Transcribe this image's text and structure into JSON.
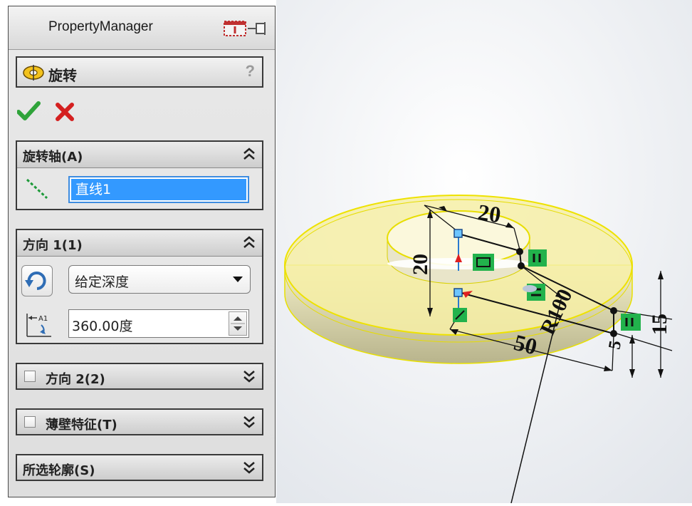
{
  "panel": {
    "title": "PropertyManager",
    "feature_name": "旋转",
    "help_label": "?",
    "ok_icon": "checkmark-icon",
    "cancel_icon": "x-icon",
    "colors": {
      "ok": "#2fa33a",
      "cancel": "#d42020",
      "selection": "#3399ff"
    }
  },
  "axis_group": {
    "label": "旋转轴(A)",
    "value": "直线1"
  },
  "direction1": {
    "label": "方向 1(1)",
    "end_condition": "给定深度",
    "angle": "360.00度"
  },
  "direction2": {
    "label": "方向 2(2)"
  },
  "thin_feature": {
    "label": "薄壁特征(T)"
  },
  "selected_contours": {
    "label": "所选轮廓(S)"
  },
  "sketch": {
    "dimensions": [
      "20",
      "20",
      "50",
      "R100",
      "15",
      "5"
    ]
  }
}
